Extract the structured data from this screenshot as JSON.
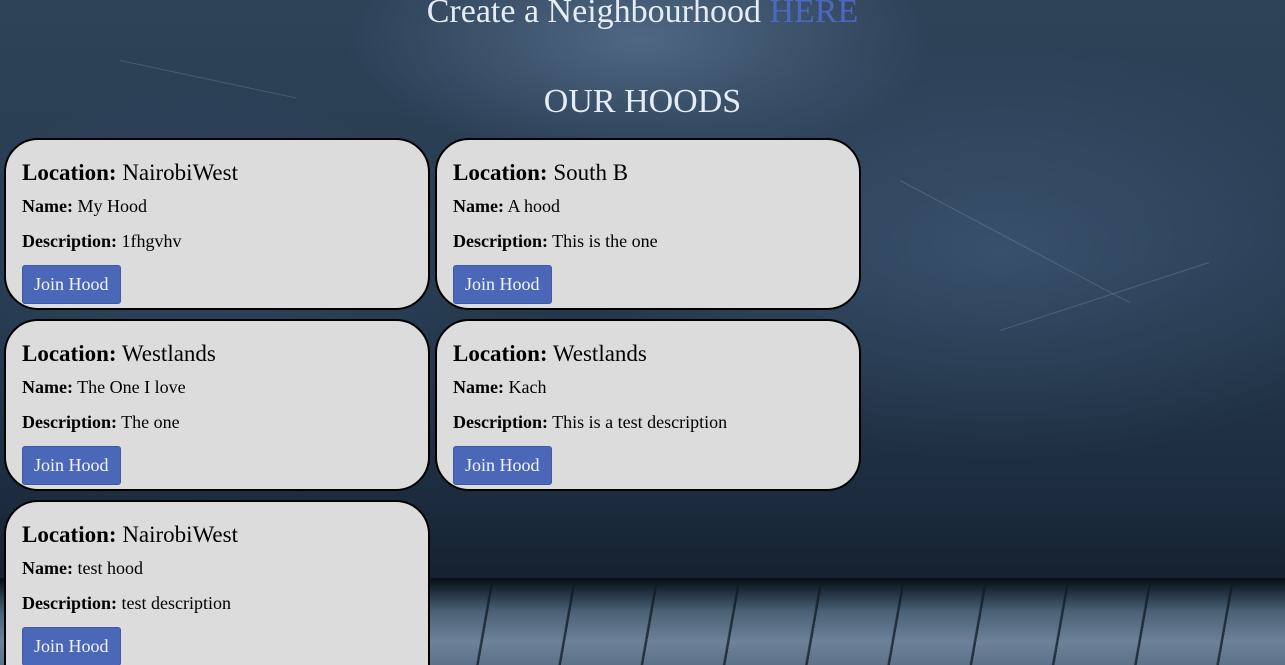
{
  "header": {
    "create_text": "Create a Neighbourhood",
    "create_link": "HERE",
    "hoods_title": "OUR HOODS"
  },
  "labels": {
    "location": "Location:",
    "name": "Name:",
    "description": "Description:",
    "join_button": "Join Hood"
  },
  "hoods": [
    {
      "location": "NairobiWest",
      "name": "My Hood",
      "description": "1fhgvhv"
    },
    {
      "location": "South B",
      "name": "A hood",
      "description": "This is the one"
    },
    {
      "location": "Westlands",
      "name": "The One I love",
      "description": "The one"
    },
    {
      "location": "Westlands",
      "name": "Kach",
      "description": "This is a test description"
    },
    {
      "location": "NairobiWest",
      "name": "test hood",
      "description": "test description"
    }
  ],
  "colors": {
    "link": "#4a6ac2",
    "button": "#4b67b8",
    "card_background": "#dcdcdc",
    "heading_text": "#e6ecf5"
  }
}
